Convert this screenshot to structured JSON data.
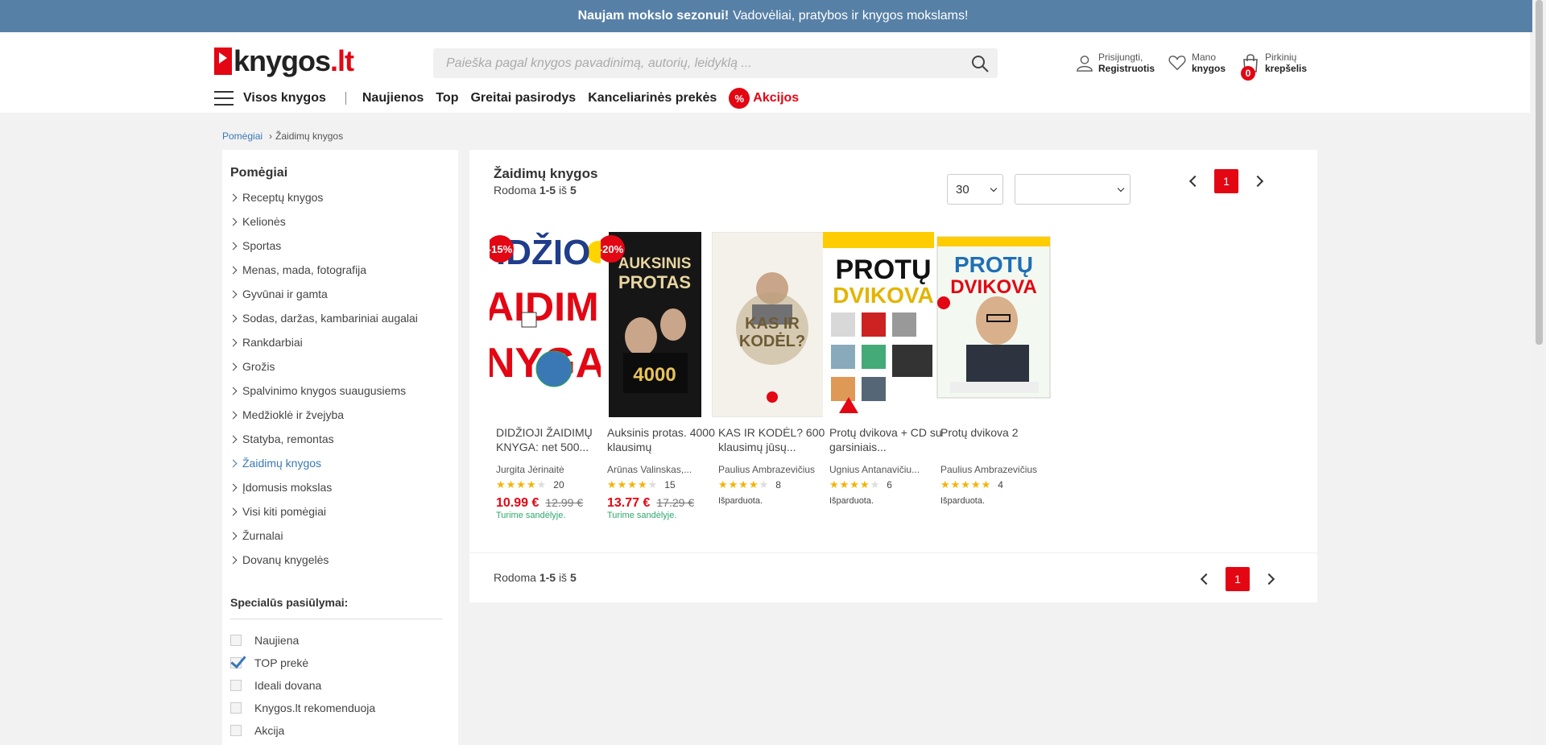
{
  "announcement": {
    "bold": "Naujam mokslo sezonui!",
    "text": "Vadovėliai, pratybos ir knygos mokslams!"
  },
  "logo": {
    "name": "knygos",
    "tld": ".lt"
  },
  "search": {
    "placeholder": "Paieška pagal knygos pavadinimą, autorių, leidyklą ..."
  },
  "header": {
    "login_line1": "Prisijungti,",
    "login_line2": "Registruotis",
    "wishlist_line1": "Mano",
    "wishlist_line2": "knygos",
    "cart_line1": "Pirkinių",
    "cart_line2": "krepšelis",
    "cart_count": "0"
  },
  "nav": {
    "all_books": "Visos knygos",
    "items": [
      "Naujienos",
      "Top",
      "Greitai pasirodys",
      "Kanceliarinės prekės"
    ],
    "sale_icon": "%",
    "sale": "Akcijos"
  },
  "breadcrumb": {
    "parent": "Pomėgiai",
    "current": "Žaidimų knygos"
  },
  "sidebar": {
    "title": "Pomėgiai",
    "categories": [
      "Receptų knygos",
      "Kelionės",
      "Sportas",
      "Menas, mada, fotografija",
      "Gyvūnai ir gamta",
      "Sodas, daržas, kambariniai augalai",
      "Rankdarbiai",
      "Grožis",
      "Spalvinimo knygos suaugusiems",
      "Medžioklė ir žvejyba",
      "Statyba, remontas",
      "Žaidimų knygos",
      "Įdomusis mokslas",
      "Visi kiti pomėgiai",
      "Žurnalai",
      "Dovanų knygelės"
    ],
    "active_index": 11,
    "special_title": "Specialūs pasiūlymai:",
    "special": [
      {
        "label": "Naujiena",
        "checked": false
      },
      {
        "label": "TOP prekė",
        "checked": true
      },
      {
        "label": "Ideali dovana",
        "checked": false
      },
      {
        "label": "Knygos.lt rekomenduoja",
        "checked": false
      },
      {
        "label": "Akcija",
        "checked": false
      }
    ]
  },
  "listing": {
    "title": "Žaidimų knygos",
    "showing_prefix": "Rodoma",
    "showing_range": "1-5",
    "showing_of": "iš",
    "showing_total": "5",
    "per_page": "30",
    "sort": "",
    "page": "1"
  },
  "products": [
    {
      "title": "DIDŽIOJI ŽAIDIMŲ KNYGA: net 500...",
      "author": "Jurgita Jėrinaitė",
      "stars": 4,
      "reviews": "20",
      "price": "10.99 €",
      "old_price": "12.99 €",
      "discount": "-15%",
      "stock": "Turime sandėlyje.",
      "status": "",
      "cover_bg": "#ffffff",
      "cover_text": "DIDŽIOJI ŽAIDIMŲ KNYGA"
    },
    {
      "title": "Auksinis protas. 4000 klausimų",
      "author": "Arūnas Valinskas,...",
      "stars": 4,
      "reviews": "15",
      "price": "13.77 €",
      "old_price": "17.29 €",
      "discount": "-20%",
      "stock": "Turime sandėlyje.",
      "status": "",
      "cover_bg": "#1c1c1c",
      "cover_text": "AUKSINIS PROTAS"
    },
    {
      "title": "KAS IR KODĖL? 600 klausimų jūsų...",
      "author": "Paulius Ambrazevičius",
      "stars": 4,
      "reviews": "8",
      "price": "",
      "old_price": "",
      "discount": "",
      "stock": "",
      "status": "Išparduota.",
      "cover_bg": "#f4f1ea",
      "cover_text": "KAS IR KODĖL?"
    },
    {
      "title": "Protų dvikova + CD su garsiniais...",
      "author": "Ugnius Antanavičiu...",
      "stars": 4,
      "reviews": "6",
      "price": "",
      "old_price": "",
      "discount": "",
      "stock": "",
      "status": "Išparduota.",
      "cover_bg": "#ffffff",
      "cover_text": "PROTŲ DVIKOVA"
    },
    {
      "title": "Protų dvikova 2",
      "author": "Paulius Ambrazevičius",
      "stars": 5,
      "reviews": "4",
      "price": "",
      "old_price": "",
      "discount": "",
      "stock": "",
      "status": "Išparduota.",
      "cover_bg": "#e8f3e8",
      "cover_text": "PROTŲ DVIKOVA"
    }
  ],
  "colors": {
    "accent": "#e30613",
    "link": "#3a78b5",
    "topbar": "#5780a6",
    "in_stock": "#2ca86b",
    "star": "#f5b301"
  },
  "icons": {
    "search": "search-icon",
    "user": "user-icon",
    "heart": "heart-icon",
    "cart": "cart-icon",
    "menu": "menu-icon"
  }
}
